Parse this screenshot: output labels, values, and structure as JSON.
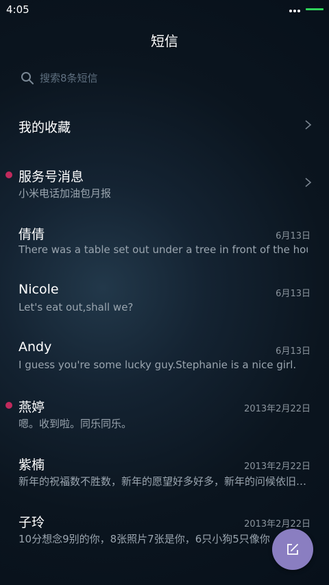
{
  "status_bar": {
    "time": "4:05"
  },
  "header": {
    "title": "短信"
  },
  "search": {
    "placeholder": "搜索8条短信"
  },
  "favorites": {
    "label": "我的收藏"
  },
  "service": {
    "title": "服务号消息",
    "preview": "小米电话加油包月报",
    "unread": true
  },
  "conversations": [
    {
      "name": "倩倩",
      "date": "6月13日",
      "preview": "There was a table set out under a tree in front of the hous",
      "unread": false
    },
    {
      "name": "Nicole",
      "date": "6月13日",
      "preview": "Let's eat out,shall we?",
      "unread": false
    },
    {
      "name": "Andy",
      "date": "6月13日",
      "preview": "I guess you're some lucky guy.Stephanie is a nice girl.",
      "unread": false
    },
    {
      "name": "燕婷",
      "date": "2013年2月22日",
      "preview": "嗯。收到啦。同乐同乐。",
      "unread": true
    },
    {
      "name": "紫楠",
      "date": "2013年2月22日",
      "preview": "新年的祝福数不胜数，新年的愿望好多好多，新年的问候依旧，新年",
      "unread": false
    },
    {
      "name": "子玲",
      "date": "2013年2月22日",
      "preview": "10分想念9别的你，8张照片7张是你，6只小狗5只像你",
      "unread": false
    }
  ],
  "colors": {
    "unread_dot": "#c02a5c",
    "fab": "#8a7ec1",
    "battery": "#2fd35a"
  },
  "icons": {
    "search": "search-icon",
    "chevron": "chevron-right-icon",
    "compose": "compose-icon"
  }
}
